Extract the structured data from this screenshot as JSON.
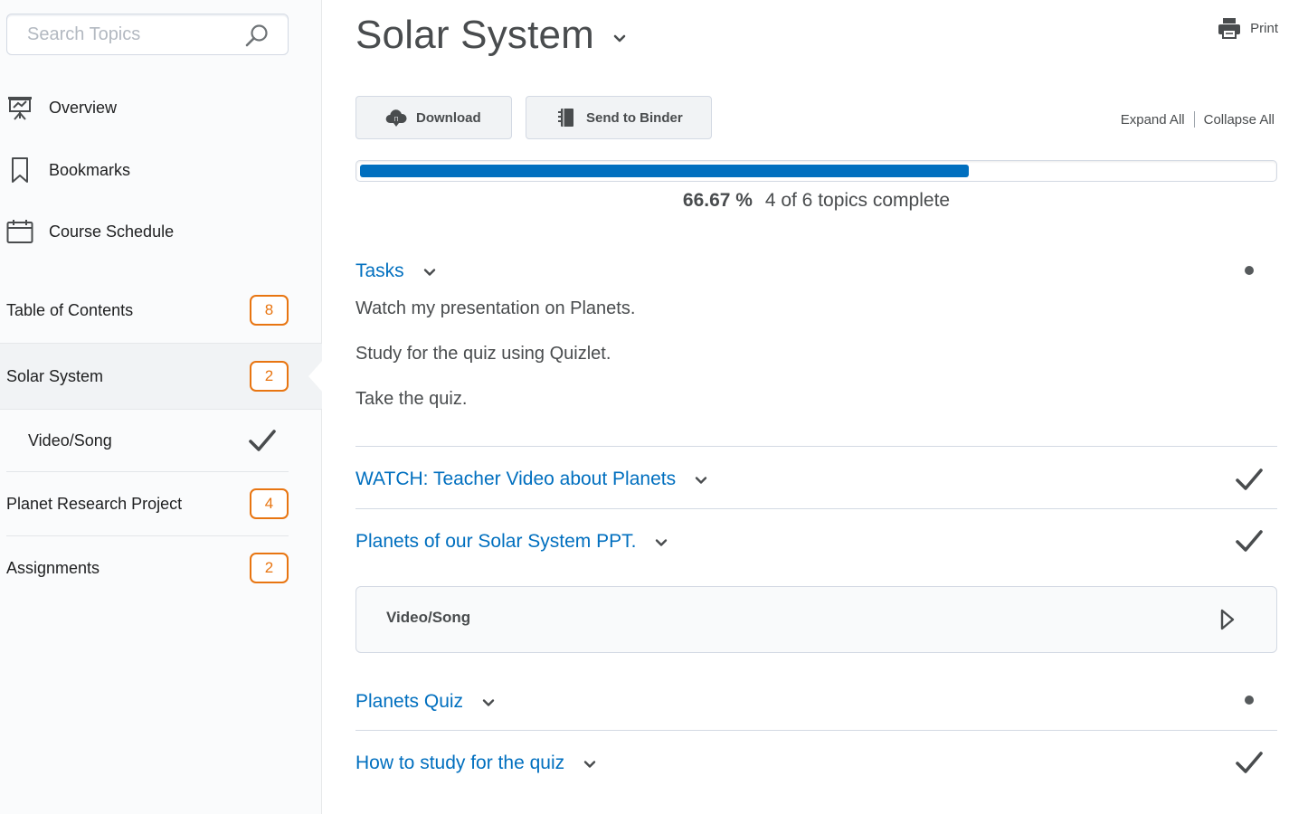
{
  "search": {
    "placeholder": "Search Topics"
  },
  "sidebar": {
    "nav": [
      {
        "label": "Overview",
        "icon": "presentation-icon"
      },
      {
        "label": "Bookmarks",
        "icon": "bookmark-icon"
      },
      {
        "label": "Course Schedule",
        "icon": "calendar-icon"
      }
    ],
    "toc": [
      {
        "label": "Table of Contents",
        "count": "8"
      },
      {
        "label": "Solar System",
        "count": "2",
        "selected": true
      },
      {
        "label": "Video/Song",
        "status": "complete"
      },
      {
        "label": "Planet Research Project",
        "count": "4"
      },
      {
        "label": "Assignments",
        "count": "2"
      }
    ]
  },
  "main": {
    "title": "Solar System",
    "print_label": "Print",
    "download_label": "Download",
    "binder_label": "Send to Binder",
    "expand_all": "Expand All",
    "collapse_all": "Collapse All",
    "progress": {
      "fraction": 0.6667,
      "percent_text": "66.67 %",
      "summary_text": "4 of 6 topics complete"
    },
    "sections": [
      {
        "title": "Tasks",
        "status": "incomplete",
        "tasks": [
          "Watch my presentation on Planets.",
          "Study for the quiz using Quizlet.",
          "Take the quiz."
        ]
      },
      {
        "title": "WATCH: Teacher Video about Planets",
        "status": "complete"
      },
      {
        "title": "Planets of our Solar System PPT.",
        "status": "complete",
        "topic": "Video/Song"
      },
      {
        "title": "Planets Quiz",
        "status": "incomplete"
      },
      {
        "title": "How to study for the quiz",
        "status": "complete"
      }
    ]
  },
  "colors": {
    "link": "#006fbf",
    "progress": "#006fbf",
    "badge": "#e87511",
    "text": "#494c4e"
  }
}
